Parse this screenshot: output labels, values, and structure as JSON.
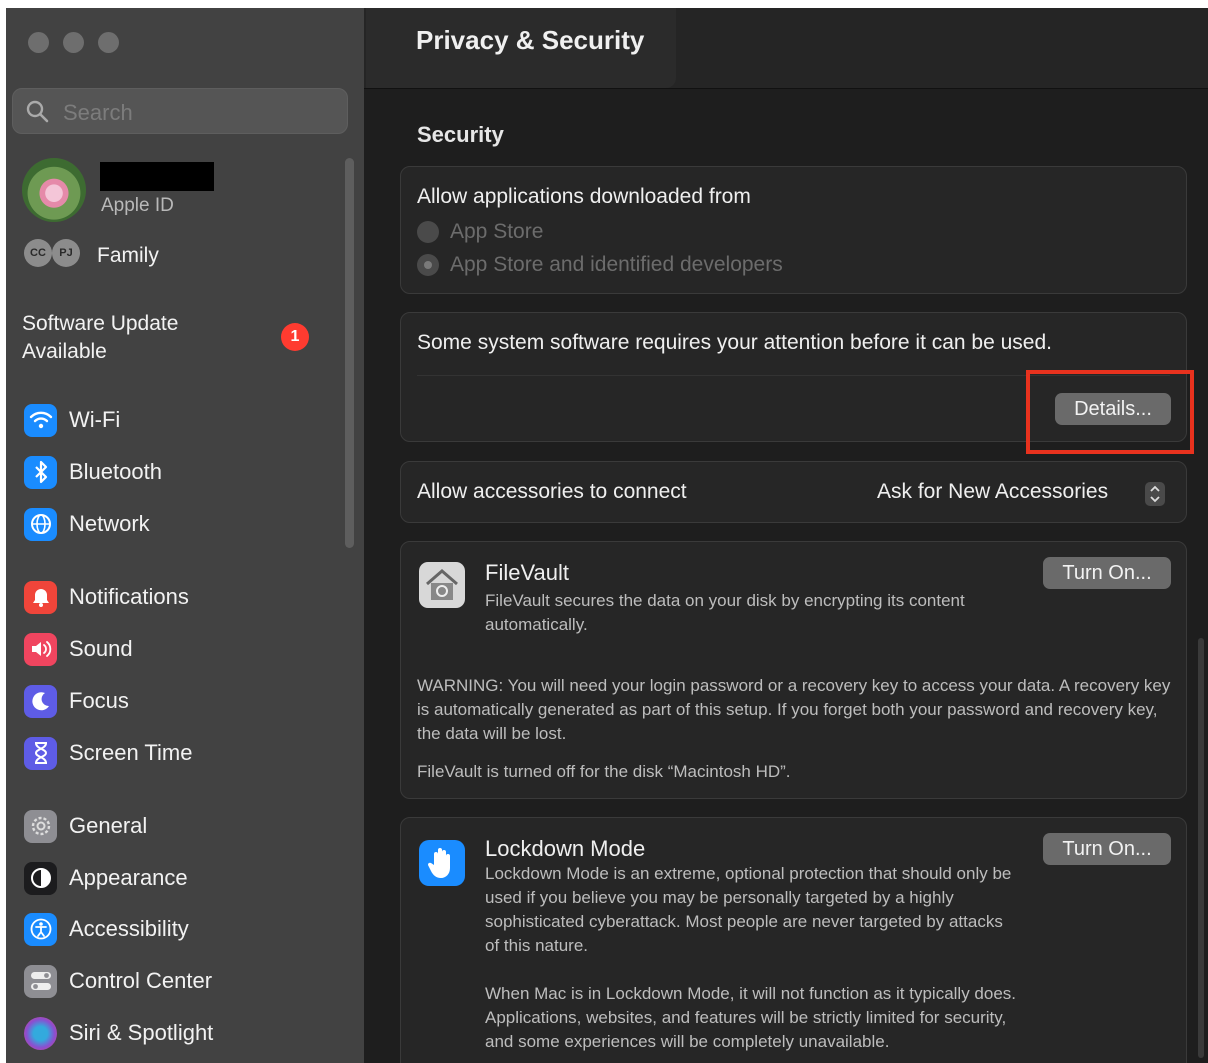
{
  "sidebar": {
    "search_placeholder": "Search",
    "account": {
      "subtitle": "Apple ID",
      "family_label": "Family",
      "family_initials": [
        "CC",
        "PJ"
      ]
    },
    "software_update": {
      "label": "Software Update Available",
      "badge": "1"
    },
    "items": [
      {
        "label": "Wi-Fi",
        "icon": "wifi-icon",
        "color": "#1a8cff"
      },
      {
        "label": "Bluetooth",
        "icon": "bluetooth-icon",
        "color": "#1a8cff"
      },
      {
        "label": "Network",
        "icon": "globe-icon",
        "color": "#1a8cff"
      },
      {
        "label": "Notifications",
        "icon": "bell-icon",
        "color": "#f0453a"
      },
      {
        "label": "Sound",
        "icon": "speaker-icon",
        "color": "#f0455f"
      },
      {
        "label": "Focus",
        "icon": "moon-icon",
        "color": "#5e5ce6"
      },
      {
        "label": "Screen Time",
        "icon": "hourglass-icon",
        "color": "#5e5ce6"
      },
      {
        "label": "General",
        "icon": "gear-icon",
        "color": "#8e8e93"
      },
      {
        "label": "Appearance",
        "icon": "appearance-icon",
        "color": "#1c1c1e"
      },
      {
        "label": "Accessibility",
        "icon": "accessibility-icon",
        "color": "#1a8cff"
      },
      {
        "label": "Control Center",
        "icon": "toggles-icon",
        "color": "#8e8e93"
      },
      {
        "label": "Siri & Spotlight",
        "icon": "siri-icon",
        "color": "#8a4fd1"
      }
    ]
  },
  "main": {
    "title": "Privacy & Security",
    "section_title": "Security",
    "allow_apps": {
      "label": "Allow applications downloaded from",
      "options": [
        "App Store",
        "App Store and identified developers"
      ],
      "selected": "App Store and identified developers"
    },
    "attention": {
      "message": "Some system software requires your attention before it can be used.",
      "button": "Details..."
    },
    "accessories": {
      "label": "Allow accessories to connect",
      "value": "Ask for New Accessories"
    },
    "filevault": {
      "title": "FileVault",
      "description": "FileVault secures the data on your disk by encrypting its content automatically.",
      "button": "Turn On...",
      "warning": "WARNING: You will need your login password or a recovery key to access your data. A recovery key is automatically generated as part of this setup. If you forget both your password and recovery key, the data will be lost.",
      "status": "FileVault is turned off for the disk “Macintosh HD”."
    },
    "lockdown": {
      "title": "Lockdown Mode",
      "description": "Lockdown Mode is an extreme, optional protection that should only be used if you believe you may be personally targeted by a highly sophisticated cyberattack. Most people are never targeted by attacks of this nature.",
      "button": "Turn On...",
      "detail": "When Mac is in Lockdown Mode, it will not function as it typically does. Applications, websites, and features will be strictly limited for security, and some experiences will be completely unavailable."
    }
  },
  "colors": {
    "highlight": "#e8321e",
    "badge": "#ff3b30"
  }
}
